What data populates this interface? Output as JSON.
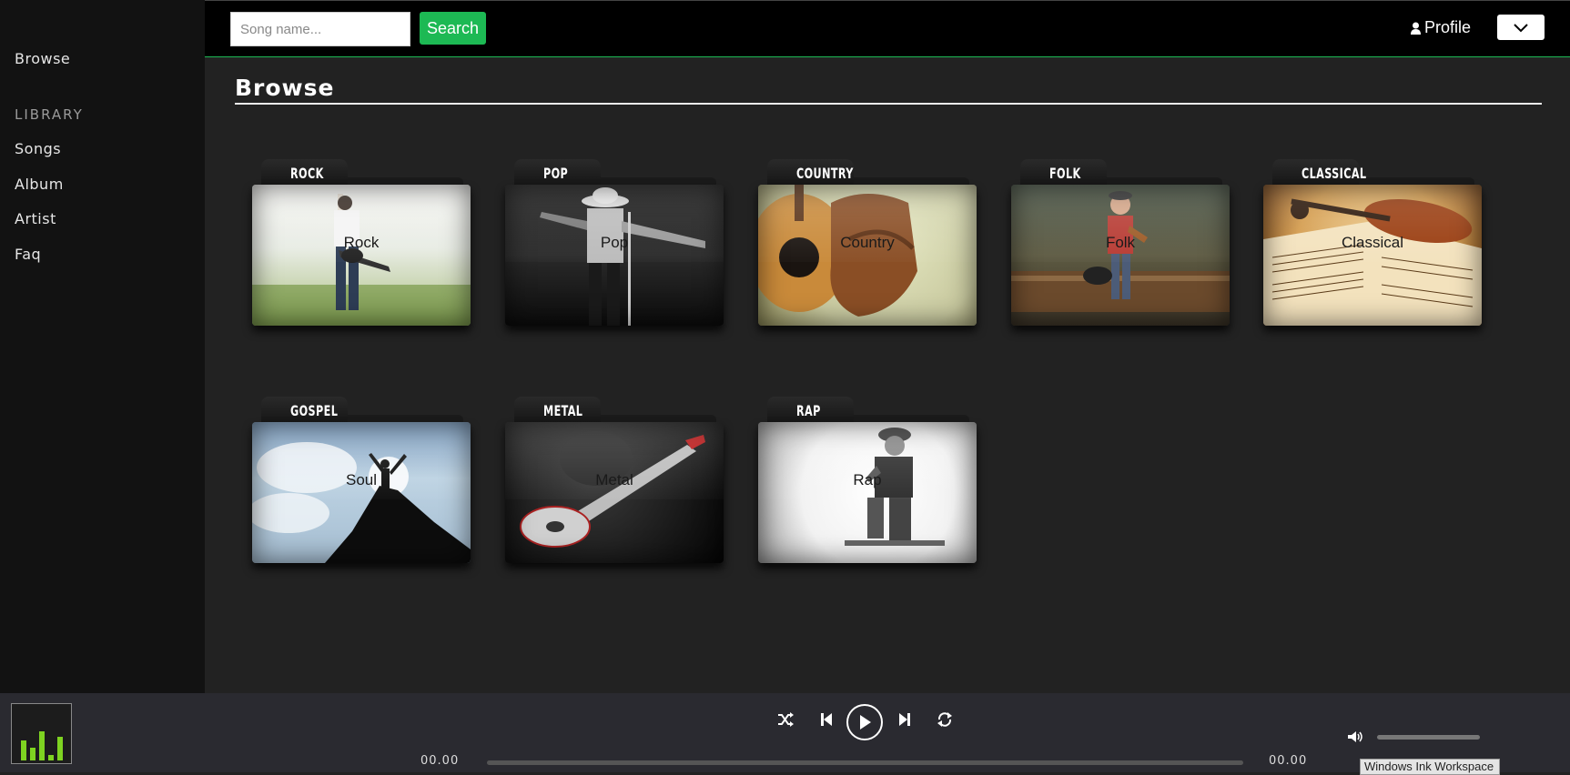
{
  "sidebar": {
    "browse": "Browse",
    "library_title": "LIBRARY",
    "items": [
      {
        "label": "Songs"
      },
      {
        "label": "Album"
      },
      {
        "label": "Artist"
      },
      {
        "label": "Faq"
      }
    ]
  },
  "topbar": {
    "search_placeholder": "Song name...",
    "search_label": "Search",
    "profile_label": "Profile"
  },
  "main": {
    "title": "Browse",
    "genres": [
      {
        "tab": "ROCK",
        "caption": "Rock"
      },
      {
        "tab": "POP",
        "caption": "Pop"
      },
      {
        "tab": "COUNTRY",
        "caption": "Country"
      },
      {
        "tab": "FOLK",
        "caption": "Folk"
      },
      {
        "tab": "CLASSICAL",
        "caption": "Classical"
      },
      {
        "tab": "GOSPEL",
        "caption": "Soul"
      },
      {
        "tab": "METAL",
        "caption": "Metal"
      },
      {
        "tab": "RAP",
        "caption": "Rap"
      }
    ]
  },
  "player": {
    "current_time": "00.00",
    "total_time": "00.00",
    "controls": [
      "shuffle-icon",
      "previous-icon",
      "play-icon",
      "next-icon",
      "repeat-icon"
    ],
    "progress": 0,
    "volume_icon": "volume-icon"
  },
  "tooltip": "Windows Ink Workspace",
  "colors": {
    "accent": "#1db954",
    "sidebar_bg": "#121212",
    "main_bg": "#222222",
    "player_bg": "#2a2a30"
  }
}
